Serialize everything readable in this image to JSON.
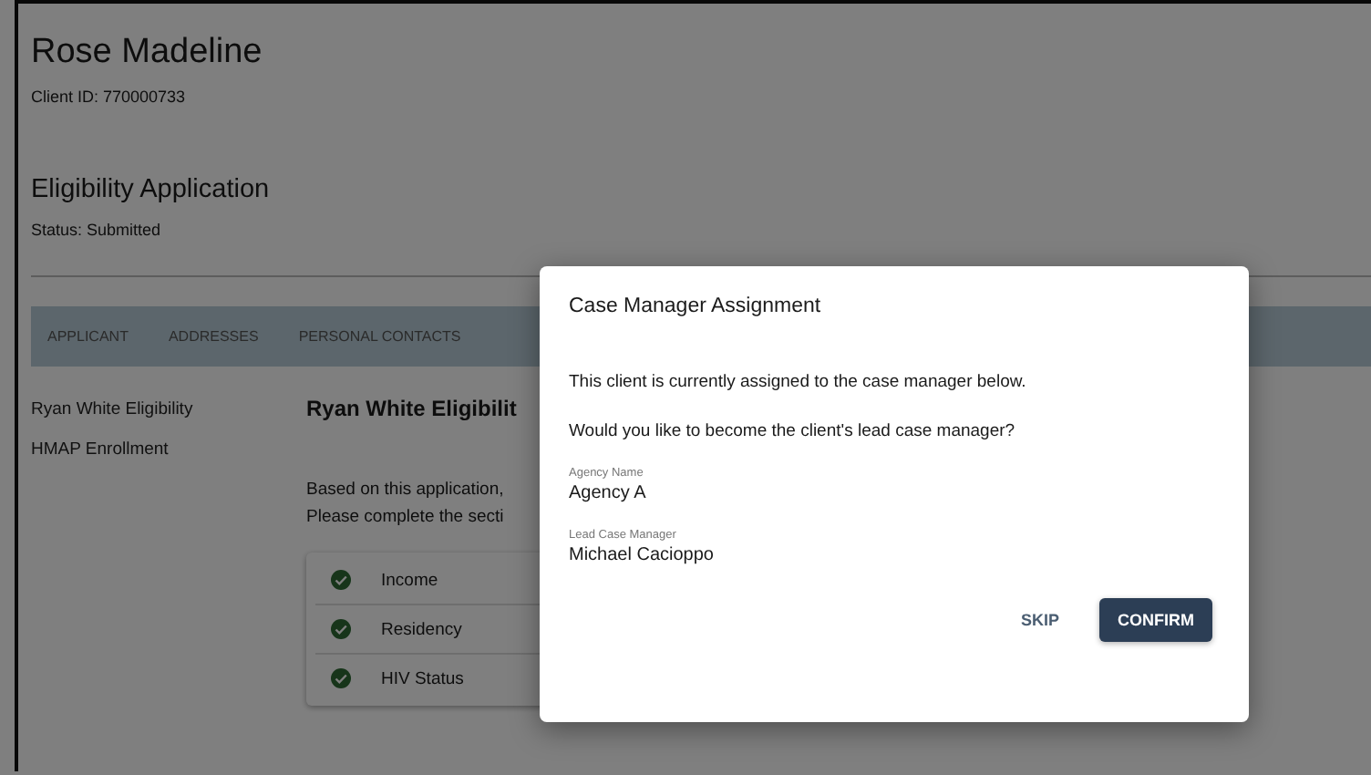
{
  "client": {
    "name": "Rose Madeline",
    "client_id": "Client ID: 770000733"
  },
  "application": {
    "title": "Eligibility Application",
    "status": "Status: Submitted"
  },
  "tabs": [
    {
      "label": "APPLICANT",
      "selected": false
    },
    {
      "label": "ADDRESSES",
      "selected": false
    },
    {
      "label": "PERSONAL CONTACTS",
      "selected": false
    }
  ],
  "sidebar": {
    "items": [
      {
        "label": "Ryan White Eligibility"
      },
      {
        "label": "HMAP Enrollment"
      }
    ]
  },
  "content": {
    "heading": "Ryan White Eligibilit",
    "lines": [
      "Based on this application,",
      "Please complete the secti"
    ],
    "sections": [
      {
        "label": "Income",
        "complete": true
      },
      {
        "label": "Residency",
        "complete": true
      },
      {
        "label": "HIV Status",
        "complete": true
      }
    ]
  },
  "dialog": {
    "title": "Case Manager Assignment",
    "messages": [
      "This client is currently assigned to the case manager below.",
      "Would you like to become the client's lead case manager?"
    ],
    "fields": [
      {
        "label": "Agency Name",
        "value": "Agency A"
      },
      {
        "label": "Lead Case Manager",
        "value": "Michael Cacioppo"
      }
    ],
    "buttons": [
      {
        "label": "SKIP",
        "kind": "text"
      },
      {
        "label": "CONFIRM",
        "kind": "primary"
      }
    ]
  }
}
